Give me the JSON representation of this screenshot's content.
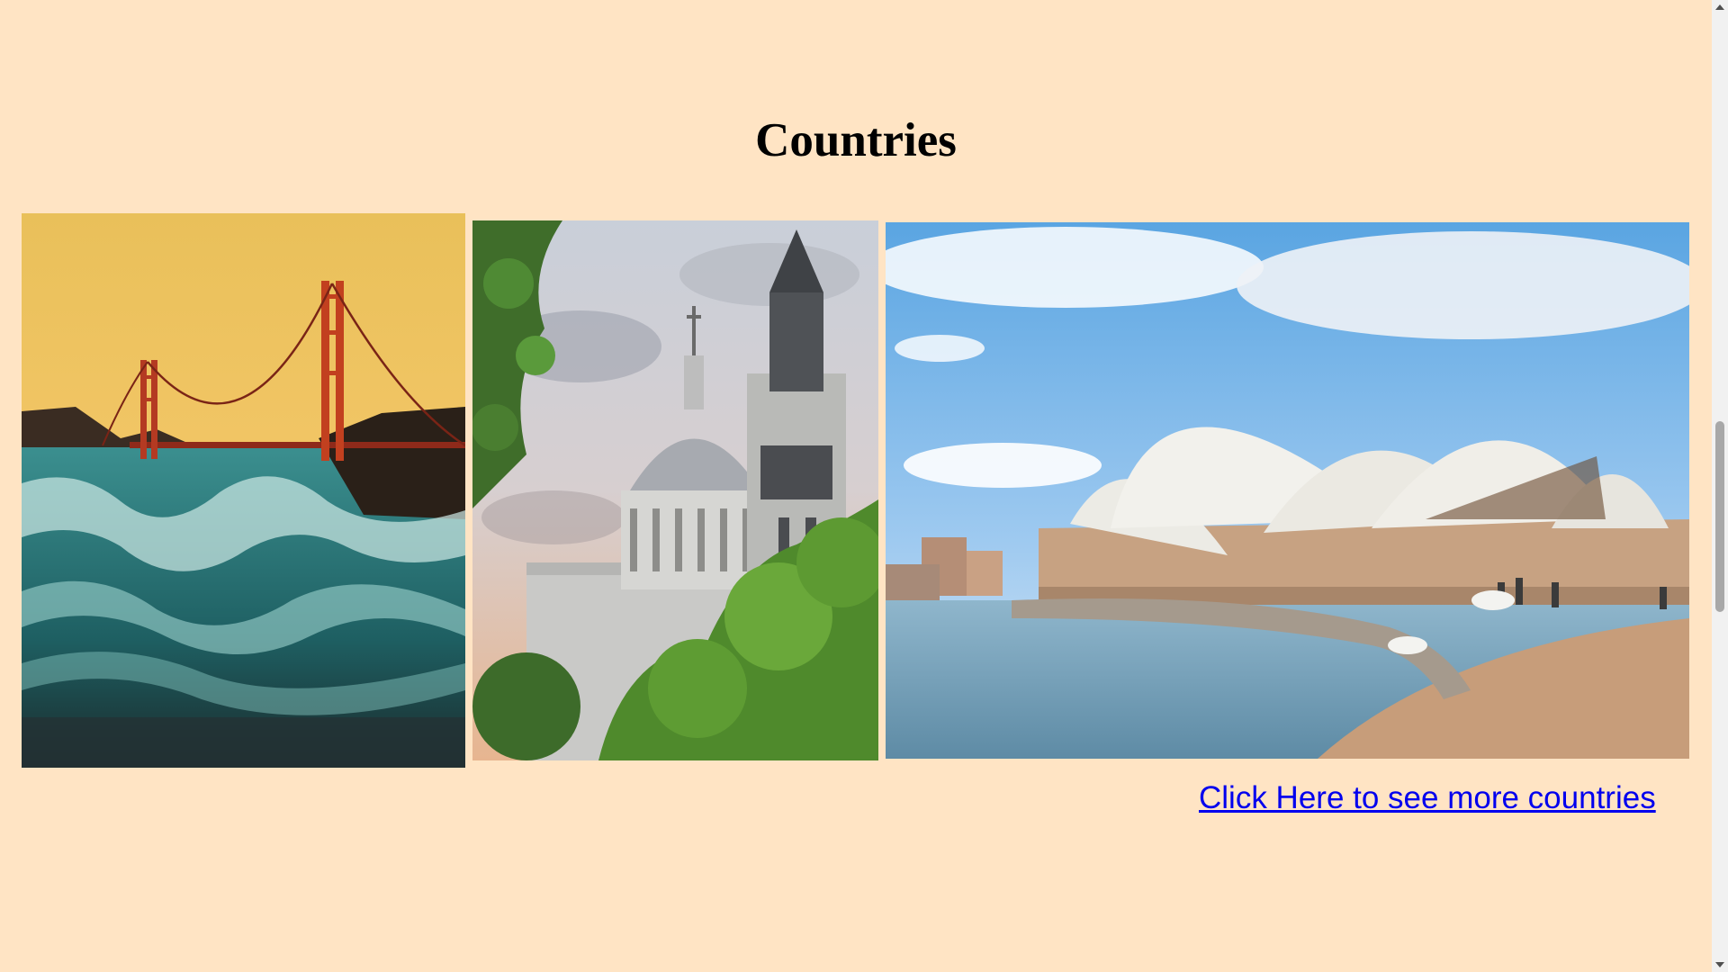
{
  "page": {
    "heading": "Countries",
    "background_color": "#ffe4c4"
  },
  "photos": [
    {
      "subject": "Golden Gate Bridge at sunset with crashing waves"
    },
    {
      "subject": "St Paul's Cathedral dome and tower with trees"
    },
    {
      "subject": "Sydney Opera House waterfront with seagulls"
    }
  ],
  "link": {
    "label": "Click Here to see more countries",
    "color": "#0000ee"
  },
  "scrollbar": {
    "up_icon": "triangle-up",
    "down_icon": "triangle-down"
  }
}
